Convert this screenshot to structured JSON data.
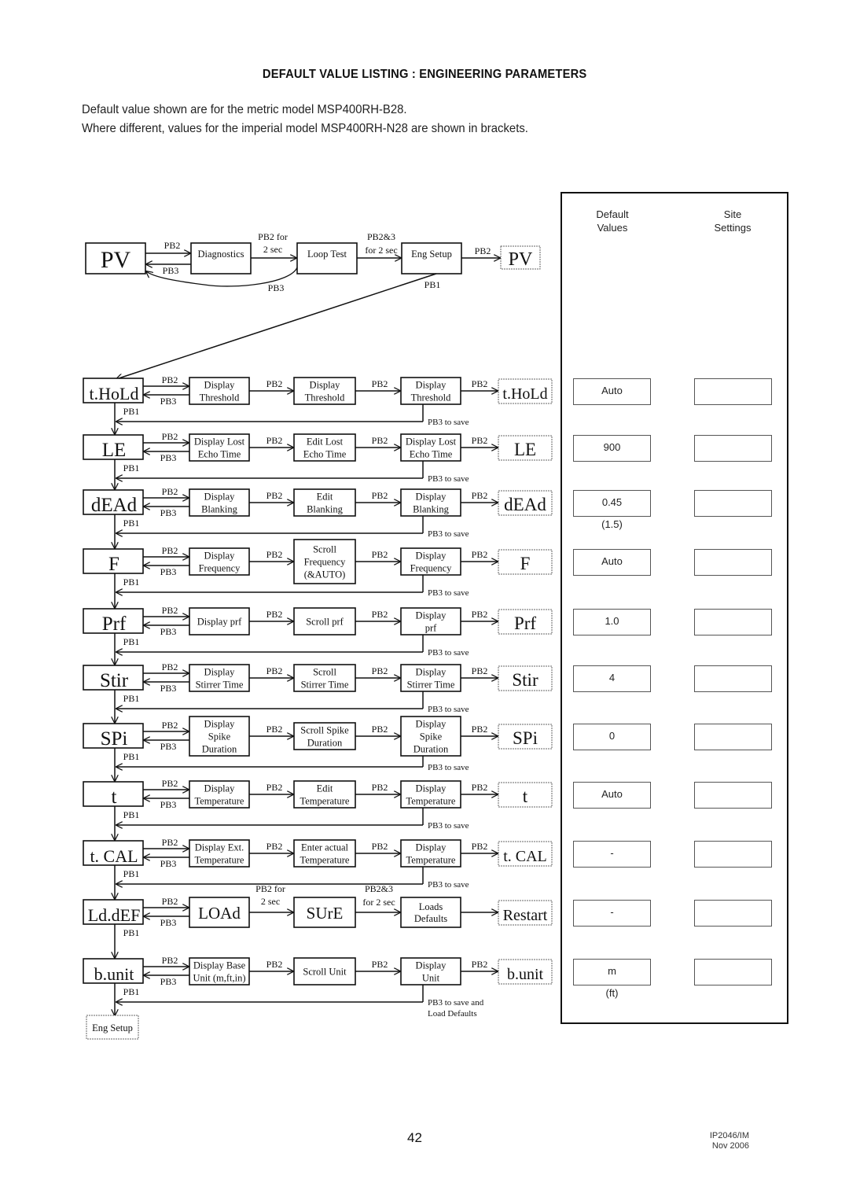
{
  "header": {
    "title": "DEFAULT VALUE LISTING : ENGINEERING PARAMETERS",
    "intro_line1": "Default value shown are for the metric model MSP400RH-B28.",
    "intro_line2": "Where different, values for the imperial model MSP400RH-N28 are shown in brackets."
  },
  "top_flow": {
    "pv_left": "PV",
    "diagnostics": "Diagnostics",
    "loop_test": "Loop Test",
    "eng_setup": "Eng Setup",
    "pv_right": "PV",
    "lbl_pb2": "PB2",
    "lbl_pb3": "PB3",
    "lbl_pb2for_1": "PB2 for",
    "lbl_pb2for_2": "2 sec",
    "lbl_pb23_1": "PB2&3",
    "lbl_pb23_2": "for 2 sec",
    "lbl_pb2_out": "PB2",
    "lbl_pb3_curve": "PB3",
    "lbl_pb1": "PB1"
  },
  "rows": [
    {
      "param": "t.HoLd",
      "box1": [
        "Display",
        "Threshold"
      ],
      "box2": [
        "Display",
        "Threshold"
      ],
      "box3": [
        "Display",
        "Threshold"
      ],
      "save": "PB3 to save",
      "default": "Auto",
      "alt": ""
    },
    {
      "param": "LE",
      "box1": [
        "Display Lost",
        "Echo Time"
      ],
      "box2": [
        "Edit Lost",
        "Echo Time"
      ],
      "box3": [
        "Display Lost",
        "Echo Time"
      ],
      "save": "PB3 to save",
      "default": "900",
      "alt": ""
    },
    {
      "param": "dEAd",
      "box1": [
        "Display",
        "Blanking"
      ],
      "box2": [
        "Edit",
        "Blanking"
      ],
      "box3": [
        "Display",
        "Blanking"
      ],
      "save": "PB3 to save",
      "default": "0.45",
      "alt": "(1.5)"
    },
    {
      "param": "F",
      "box1": [
        "Display",
        "Frequency"
      ],
      "box2": [
        "Scroll",
        "Frequency",
        "(&AUTO)"
      ],
      "box3": [
        "Display",
        "Frequency"
      ],
      "save": "PB3 to save",
      "default": "Auto",
      "alt": "",
      "no_pb2_in": true
    },
    {
      "param": "Prf",
      "box1": [
        "Display prf"
      ],
      "box2": [
        "Scroll prf"
      ],
      "box3": [
        "Display",
        "prf"
      ],
      "save": "PB3 to save",
      "default": "1.0",
      "alt": ""
    },
    {
      "param": "Stir",
      "box1": [
        "Display",
        "Stirrer Time"
      ],
      "box2": [
        "Scroll",
        "Stirrer Time"
      ],
      "box3": [
        "Display",
        "Stirrer Time"
      ],
      "save": "PB3 to save",
      "default": "4",
      "alt": ""
    },
    {
      "param": "SPi",
      "box1": [
        "Display",
        "Spike",
        "Duration"
      ],
      "box2": [
        "Scroll Spike",
        "Duration"
      ],
      "box3": [
        "Display",
        "Spike",
        "Duration"
      ],
      "save": "PB3 to save",
      "default": "0",
      "alt": ""
    },
    {
      "param": "t",
      "box1": [
        "Display",
        "Temperature"
      ],
      "box2": [
        "Edit",
        "Temperature"
      ],
      "box3": [
        "Display",
        "Temperature"
      ],
      "save": "PB3 to save",
      "default": "Auto",
      "alt": ""
    },
    {
      "param": "t. CAL",
      "box1": [
        "Display Ext.",
        "Temperature"
      ],
      "box2": [
        "Enter actual",
        "Temperature"
      ],
      "box3": [
        "Display",
        "Temperature"
      ],
      "save": "PB3 to save",
      "default": "-",
      "alt": "",
      "no_pb2_in": true
    },
    {
      "param": "Ld.dEF",
      "box1": [
        "LOAd"
      ],
      "box2": [
        "SUrE"
      ],
      "box3": [
        "Loads",
        "Defaults"
      ],
      "save": "",
      "default": "-",
      "alt": "",
      "special": "load",
      "out": "Restart"
    },
    {
      "param": "b.unit",
      "box1": [
        "Display Base",
        "Unit (m,ft,in)"
      ],
      "box2": [
        "Scroll Unit"
      ],
      "box3": [
        "Display",
        "Unit"
      ],
      "save": "PB3 to save and|Load Defaults",
      "default": "m",
      "alt": "(ft)",
      "no_pb2_in": true
    }
  ],
  "labels": {
    "pb1": "PB1",
    "pb2": "PB2",
    "pb3": "PB3",
    "pb2for": [
      "PB2 for",
      "2 sec"
    ],
    "pb23": [
      "PB2&3",
      "for 2 sec"
    ],
    "end": "Eng Setup"
  },
  "panel": {
    "col1": [
      "Default",
      "Values"
    ],
    "col2": [
      "Site",
      "Settings"
    ]
  },
  "footer": {
    "page": "42",
    "doc_id": "IP2046/IM",
    "date": "Nov 2006"
  }
}
